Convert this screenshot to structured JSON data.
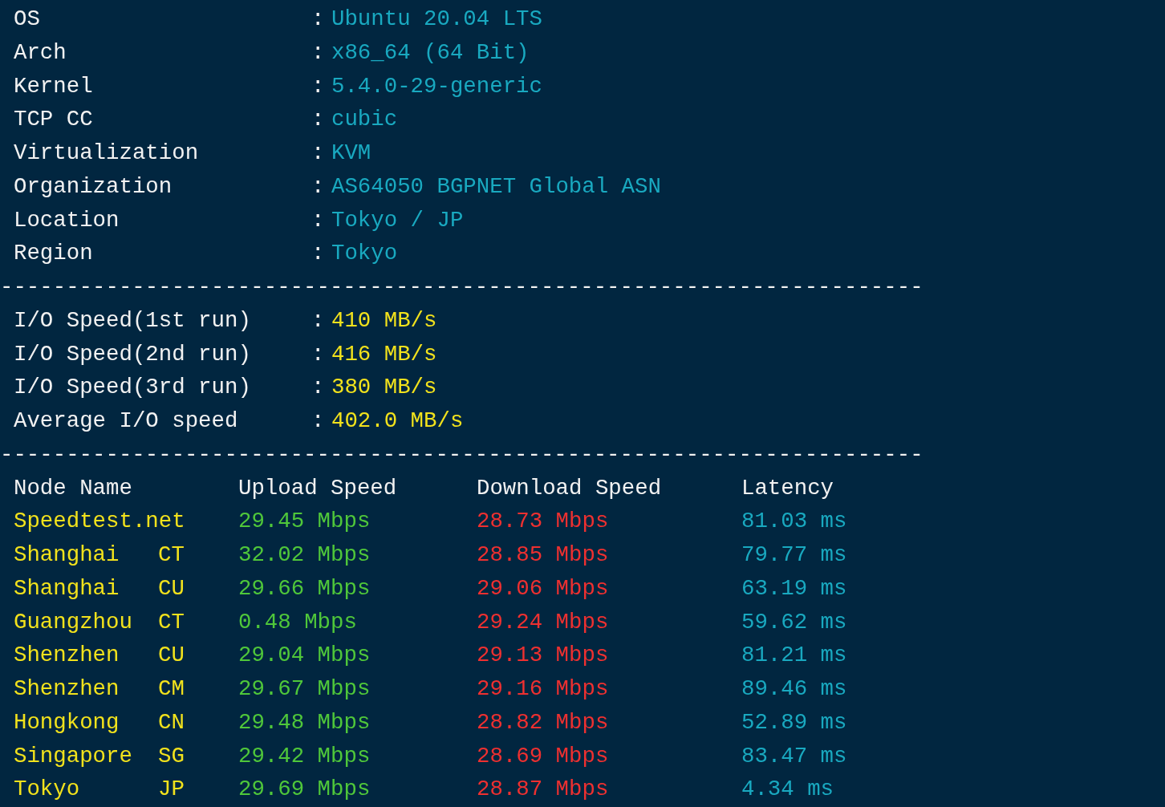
{
  "system_info": [
    {
      "label": "OS",
      "value": "Ubuntu 20.04 LTS"
    },
    {
      "label": "Arch",
      "value": "x86_64 (64 Bit)"
    },
    {
      "label": "Kernel",
      "value": "5.4.0-29-generic"
    },
    {
      "label": "TCP CC",
      "value": "cubic"
    },
    {
      "label": "Virtualization",
      "value": "KVM"
    },
    {
      "label": "Organization",
      "value": "AS64050 BGPNET Global ASN"
    },
    {
      "label": "Location",
      "value": "Tokyo / JP"
    },
    {
      "label": "Region",
      "value": "Tokyo"
    }
  ],
  "separator_1": "----------------------------------------------------------------------",
  "io_results": [
    {
      "label": "I/O Speed(1st run)",
      "value": "410 MB/s"
    },
    {
      "label": "I/O Speed(2nd run)",
      "value": "416 MB/s"
    },
    {
      "label": "I/O Speed(3rd run)",
      "value": "380 MB/s"
    },
    {
      "label": "Average I/O speed",
      "value": "402.0 MB/s"
    }
  ],
  "separator_2": "----------------------------------------------------------------------",
  "colon": ":",
  "speed_table": {
    "columns": [
      "Node Name",
      "Upload Speed",
      "Download Speed",
      "Latency"
    ],
    "rows": [
      {
        "node": "Speedtest.net",
        "upload": "29.45 Mbps",
        "download": "28.73 Mbps",
        "latency": "81.03 ms"
      },
      {
        "node": "Shanghai",
        "isp": "CT",
        "upload": "32.02 Mbps",
        "download": "28.85 Mbps",
        "latency": "79.77 ms"
      },
      {
        "node": "Shanghai",
        "isp": "CU",
        "upload": "29.66 Mbps",
        "download": "29.06 Mbps",
        "latency": "63.19 ms"
      },
      {
        "node": "Guangzhou",
        "isp": "CT",
        "upload": "0.48 Mbps",
        "download": "29.24 Mbps",
        "latency": "59.62 ms"
      },
      {
        "node": "Shenzhen",
        "isp": "CU",
        "upload": "29.04 Mbps",
        "download": "29.13 Mbps",
        "latency": "81.21 ms"
      },
      {
        "node": "Shenzhen",
        "isp": "CM",
        "upload": "29.67 Mbps",
        "download": "29.16 Mbps",
        "latency": "89.46 ms"
      },
      {
        "node": "Hongkong",
        "isp": "CN",
        "upload": "29.48 Mbps",
        "download": "28.82 Mbps",
        "latency": "52.89 ms"
      },
      {
        "node": "Singapore",
        "isp": "SG",
        "upload": "29.42 Mbps",
        "download": "28.69 Mbps",
        "latency": "83.47 ms"
      },
      {
        "node": "Tokyo",
        "isp": "JP",
        "upload": "29.69 Mbps",
        "download": "28.87 Mbps",
        "latency": "4.34 ms"
      }
    ]
  }
}
